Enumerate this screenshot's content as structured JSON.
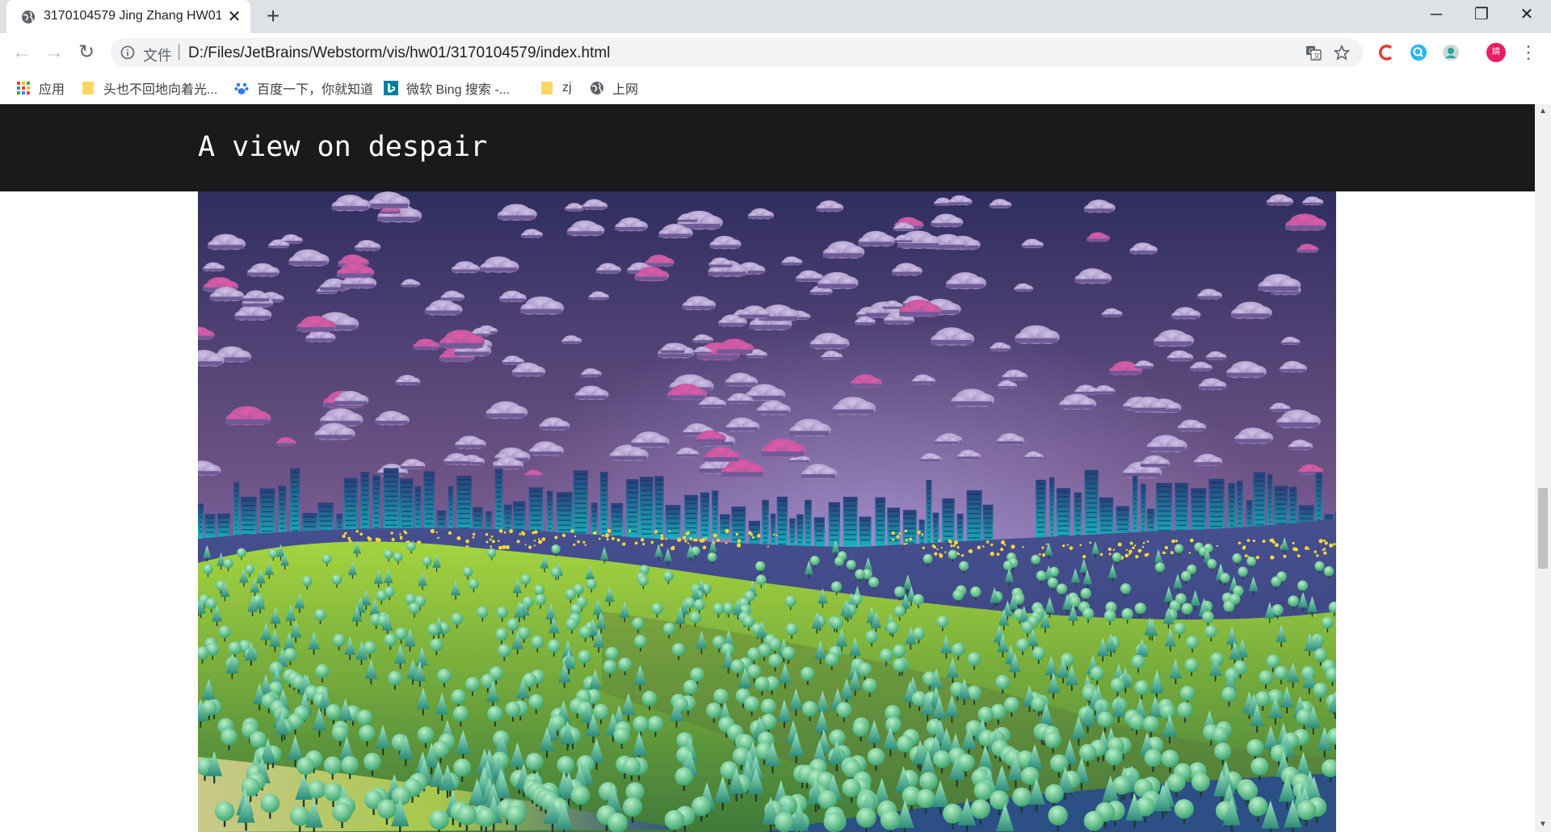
{
  "browser": {
    "tab": {
      "title": "3170104579 Jing Zhang HW01",
      "close_glyph": "✕",
      "favicon": "globe-icon"
    },
    "new_tab_glyph": "+",
    "window_controls": {
      "minimize": "─",
      "restore": "❐",
      "close": "✕"
    },
    "nav": {
      "back": "←",
      "forward": "→",
      "reload": "↻"
    },
    "omnibox": {
      "security_label": "文件",
      "separator": "|",
      "url": "D:/Files/JetBrains/Webstorm/vis/hw01/3170104579/index.html",
      "icons": [
        "translate-icon",
        "bookmark-star-icon"
      ]
    },
    "extensions": [
      "extension-red-icon",
      "extension-blue-icon",
      "extension-green-icon"
    ],
    "profile_initial": "婧",
    "menu_glyph": "⋮",
    "bookmarks": [
      {
        "label": "应用",
        "icon": "apps-icon"
      },
      {
        "label": "头也不回地向着光...",
        "icon": "folder-icon"
      },
      {
        "label": "百度一下，你就知道",
        "icon": "baidu-paw-icon"
      },
      {
        "label": "微软 Bing 搜索 -...",
        "icon": "bing-icon"
      },
      {
        "label": "zj",
        "icon": "folder-icon"
      },
      {
        "label": "上网",
        "icon": "globe-icon"
      }
    ]
  },
  "page": {
    "header_title": "A view on despair",
    "hero_image": "night-city-forest-illustration"
  },
  "colors": {
    "header_bg": "#1a1a1a",
    "sky_top": "#2f2e5f",
    "sky_mid": "#6e5386",
    "sky_horizon": "#8d82c6",
    "city": "#1ba3b3",
    "city_lights": "#ffd93a",
    "hills_far": "#3e4b86",
    "hills_green": "#8cc636",
    "trees": "#58c98a"
  }
}
